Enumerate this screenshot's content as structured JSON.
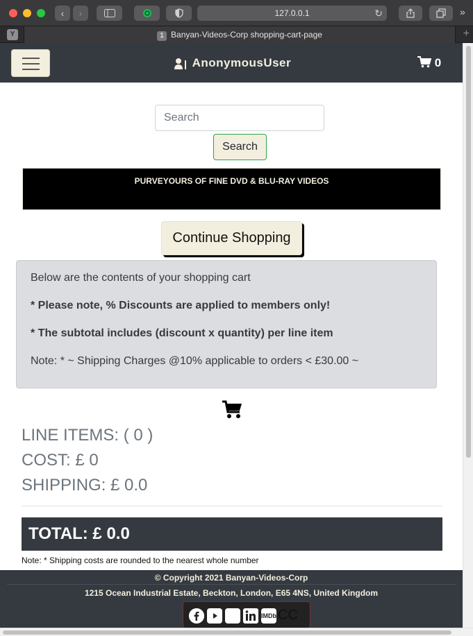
{
  "browser": {
    "url": "127.0.0.1",
    "tab_badge": "Y",
    "tab_number": "1",
    "tab_title": "Banyan-Videos-Corp shopping-cart-page",
    "new_tab": "+"
  },
  "navbar": {
    "username": "AnonymousUser",
    "cart_count": "0"
  },
  "search": {
    "placeholder": "Search",
    "button_label": "Search"
  },
  "banner": {
    "text": "PURVEYOURS OF FINE DVD & BLU-RAY VIDEOS"
  },
  "continue_label": "Continue Shopping",
  "info": {
    "line1": "Below are the contents of your shopping cart",
    "line2": "* Please note, % Discounts are applied to members only!",
    "line3": "* The subtotal includes (discount x quantity) per line item",
    "line4": "Note: * ~ Shipping Charges @10% applicable to orders < £30.00 ~"
  },
  "summary": {
    "line_items": "LINE ITEMS: ( 0 )",
    "cost": "COST: £ 0",
    "shipping": "SHIPPING: £ 0.0",
    "total": "TOTAL: £ 0.0",
    "note": "Note: * Shipping costs are rounded to the nearest whole number"
  },
  "footer": {
    "copyright": "© Copyright 2021 Banyan-Videos-Corp",
    "address": "1215 Ocean Industrial Estate, Beckton, London, E65 4NS, United Kingdom",
    "social": [
      "facebook-icon",
      "youtube-icon",
      "instagram-icon",
      "linkedin-icon",
      "imdb-icon"
    ],
    "imdb_label": "IMDb",
    "cc_label": "CC"
  },
  "colors": {
    "navbar": "#343a40",
    "cream": "#f3efdf",
    "info_bg": "#dcdde0"
  }
}
